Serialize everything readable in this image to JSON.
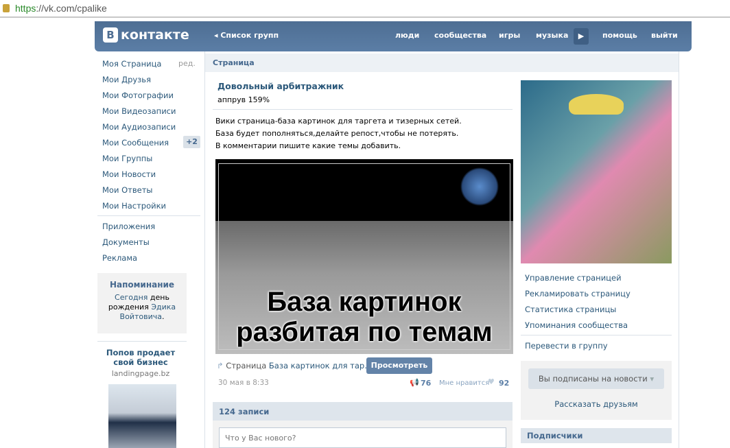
{
  "browser": {
    "url_scheme": "https",
    "url_rest": "://vk.com/cpalike"
  },
  "header": {
    "logo_letter": "В",
    "logo_text": "контакте",
    "back_label": "Список групп",
    "nav": [
      "люди",
      "сообщества",
      "игры",
      "музыка",
      "помощь",
      "выйти"
    ]
  },
  "left_menu": {
    "items": [
      "Моя Страница",
      "Мои Друзья",
      "Мои Фотографии",
      "Мои Видеозаписи",
      "Мои Аудиозаписи",
      "Мои Сообщения",
      "Мои Группы",
      "Мои Новости",
      "Мои Ответы",
      "Мои Настройки"
    ],
    "edit_label": "ред.",
    "messages_badge": "+2",
    "extra": [
      "Приложения",
      "Документы",
      "Реклама"
    ]
  },
  "reminder": {
    "title": "Напоминание",
    "today": "Сегодня",
    "day_text": " день рождения ",
    "name": "Эдика Войтовича",
    "end": "."
  },
  "ad": {
    "title": "Попов продает свой бизнес",
    "domain": "landingpage.bz"
  },
  "page": {
    "section_label": "Страница",
    "title": "Довольный арбитражник",
    "status": "аппрув 159%",
    "post_lines": [
      "Вики страница-база картинок для таргета и тизерных сетей.",
      "База будет пополняться,делайте репост,чтобы не потерять.",
      "В комментарии пишите какие темы добавить."
    ],
    "image_caption_1": "База картинок",
    "image_caption_2": "разбитая по темам",
    "attach_prefix": "Страница",
    "attach_link": "База картинок для тар..",
    "view_button": "Просмотреть",
    "date": "30 мая в 8:33",
    "reposts": "76",
    "like_label": "Мне нравится",
    "likes": "92",
    "posts_count": "124 записи",
    "new_post_placeholder": "Что у Вас нового?"
  },
  "right": {
    "links": [
      "Управление страницей",
      "Рекламировать страницу",
      "Статистика страницы",
      "Упоминания сообщества"
    ],
    "convert": "Перевести в группу",
    "subscribed_button": "Вы подписаны на новости",
    "tell_friends": "Рассказать друзьям",
    "subscribers_title": "Подписчики"
  }
}
